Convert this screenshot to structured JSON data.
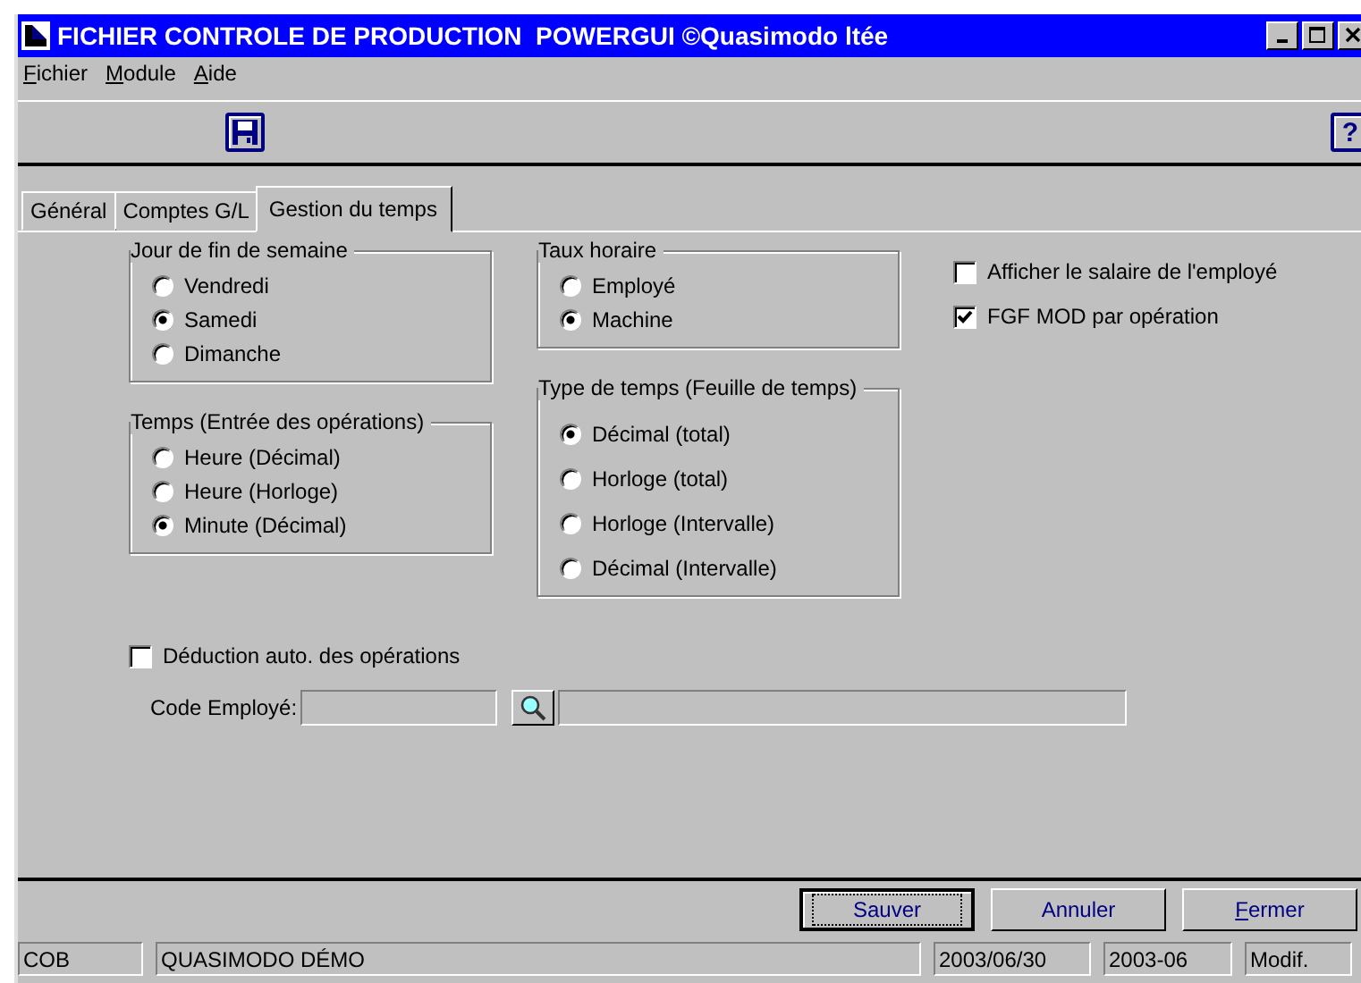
{
  "window": {
    "title": "FICHIER CONTROLE DE PRODUCTION  POWERGUI ©Quasimodo ltée"
  },
  "menu": [
    "Fichier",
    "Module",
    "Aide"
  ],
  "toolbar": {
    "help_button": "?"
  },
  "tabs": [
    {
      "label": "Général",
      "selected": false
    },
    {
      "label": "Comptes G/L",
      "selected": false
    },
    {
      "label": "Gestion du temps",
      "selected": true
    }
  ],
  "column_1": [
    {
      "title": "Jour de fin de semaine",
      "options": [
        {
          "label": "Vendredi",
          "selected": false
        },
        {
          "label": "Samedi",
          "selected": true
        },
        {
          "label": "Dimanche",
          "selected": false
        }
      ]
    },
    {
      "title": "Temps (Entrée des opérations)",
      "options": [
        {
          "label": "Heure (Décimal)",
          "selected": false
        },
        {
          "label": "Heure (Horloge)",
          "selected": false
        },
        {
          "label": "Minute (Décimal)",
          "selected": true
        }
      ]
    }
  ],
  "column_2": [
    {
      "title": "Taux horaire",
      "options": [
        {
          "label": "Employé",
          "selected": false
        },
        {
          "label": "Machine",
          "selected": true
        }
      ]
    },
    {
      "title": "Type de temps (Feuille de temps)",
      "options": [
        {
          "label": "Décimal (total)",
          "selected": true
        },
        {
          "label": "Horloge (total)",
          "selected": false
        },
        {
          "label": "Horloge (Intervalle)",
          "selected": false
        },
        {
          "label": "Décimal (Intervalle)",
          "selected": false
        }
      ]
    }
  ],
  "checkboxes": [
    {
      "label": "Afficher le salaire de l'employé",
      "checked": false
    },
    {
      "label": "FGF MOD par opération",
      "checked": true
    }
  ],
  "deduction": {
    "label": "Déduction auto. des opérations",
    "checked": false
  },
  "code_field": {
    "label": "Code Employé:"
  },
  "buttons": [
    {
      "label": "Sauver",
      "default": true,
      "mnemonic": false
    },
    {
      "label": "Annuler",
      "default": false,
      "mnemonic": false
    },
    {
      "label": "Fermer",
      "default": false,
      "mnemonic": true
    }
  ],
  "status_bar": [
    "COB",
    "QUASIMODO DÉMO",
    "2003/06/30",
    "2003-06",
    "Modif."
  ]
}
